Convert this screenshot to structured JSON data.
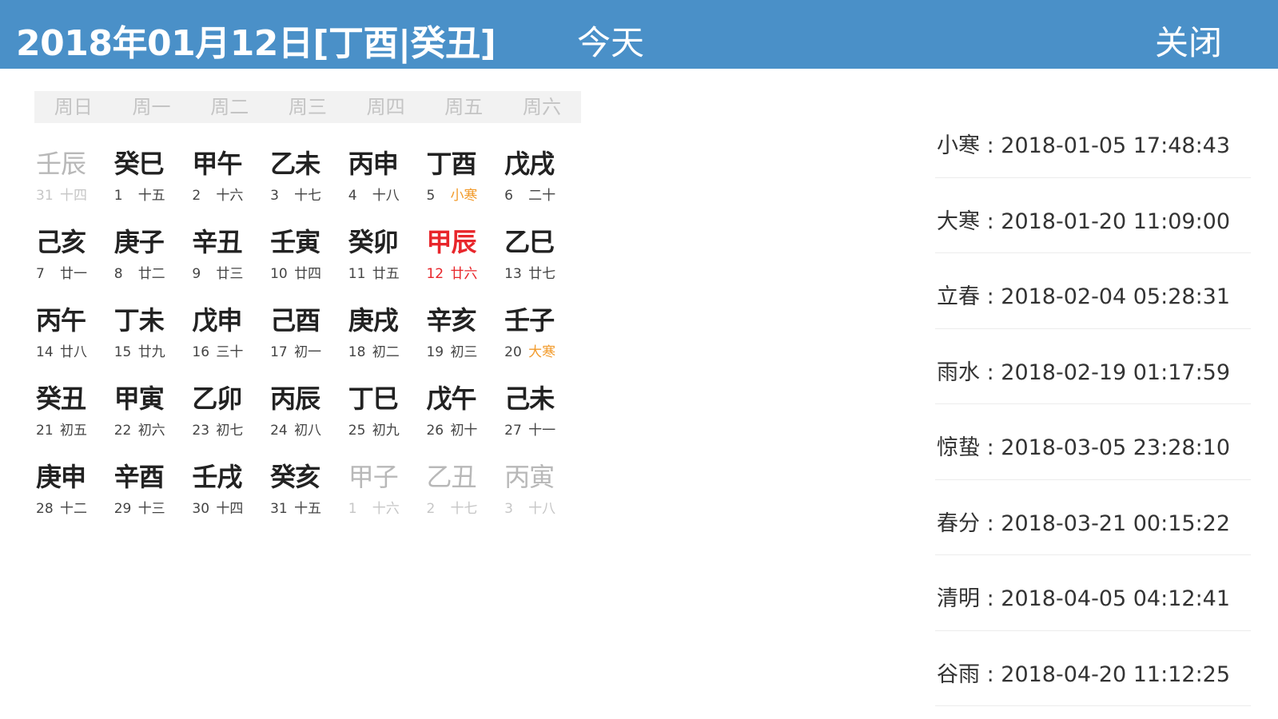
{
  "header": {
    "title": "2018年01月12日[丁酉|癸丑]",
    "today_label": "今天",
    "close_label": "关闭"
  },
  "colors": {
    "header_bg": "#4a90c8",
    "selected": "#e8262b",
    "solar_term": "#f29b2c"
  },
  "weekdays": [
    "周日",
    "周一",
    "周二",
    "周三",
    "周四",
    "周五",
    "周六"
  ],
  "calendar": {
    "selected_day": 12,
    "weeks": [
      [
        {
          "gz": "壬辰",
          "day": "31",
          "lunar": "十四",
          "other": true
        },
        {
          "gz": "癸巳",
          "day": "1",
          "lunar": "十五"
        },
        {
          "gz": "甲午",
          "day": "2",
          "lunar": "十六"
        },
        {
          "gz": "乙未",
          "day": "3",
          "lunar": "十七"
        },
        {
          "gz": "丙申",
          "day": "4",
          "lunar": "十八"
        },
        {
          "gz": "丁酉",
          "day": "5",
          "lunar": "小寒",
          "term": true
        },
        {
          "gz": "戊戌",
          "day": "6",
          "lunar": "二十"
        }
      ],
      [
        {
          "gz": "己亥",
          "day": "7",
          "lunar": "廿一"
        },
        {
          "gz": "庚子",
          "day": "8",
          "lunar": "廿二"
        },
        {
          "gz": "辛丑",
          "day": "9",
          "lunar": "廿三"
        },
        {
          "gz": "壬寅",
          "day": "10",
          "lunar": "廿四"
        },
        {
          "gz": "癸卯",
          "day": "11",
          "lunar": "廿五"
        },
        {
          "gz": "甲辰",
          "day": "12",
          "lunar": "廿六",
          "selected": true
        },
        {
          "gz": "乙巳",
          "day": "13",
          "lunar": "廿七"
        }
      ],
      [
        {
          "gz": "丙午",
          "day": "14",
          "lunar": "廿八"
        },
        {
          "gz": "丁未",
          "day": "15",
          "lunar": "廿九"
        },
        {
          "gz": "戊申",
          "day": "16",
          "lunar": "三十"
        },
        {
          "gz": "己酉",
          "day": "17",
          "lunar": "初一"
        },
        {
          "gz": "庚戌",
          "day": "18",
          "lunar": "初二"
        },
        {
          "gz": "辛亥",
          "day": "19",
          "lunar": "初三"
        },
        {
          "gz": "壬子",
          "day": "20",
          "lunar": "大寒",
          "term": true
        }
      ],
      [
        {
          "gz": "癸丑",
          "day": "21",
          "lunar": "初五"
        },
        {
          "gz": "甲寅",
          "day": "22",
          "lunar": "初六"
        },
        {
          "gz": "乙卯",
          "day": "23",
          "lunar": "初七"
        },
        {
          "gz": "丙辰",
          "day": "24",
          "lunar": "初八"
        },
        {
          "gz": "丁巳",
          "day": "25",
          "lunar": "初九"
        },
        {
          "gz": "戊午",
          "day": "26",
          "lunar": "初十"
        },
        {
          "gz": "己未",
          "day": "27",
          "lunar": "十一"
        }
      ],
      [
        {
          "gz": "庚申",
          "day": "28",
          "lunar": "十二"
        },
        {
          "gz": "辛酉",
          "day": "29",
          "lunar": "十三"
        },
        {
          "gz": "壬戌",
          "day": "30",
          "lunar": "十四"
        },
        {
          "gz": "癸亥",
          "day": "31",
          "lunar": "十五"
        },
        {
          "gz": "甲子",
          "day": "1",
          "lunar": "十六",
          "other": true
        },
        {
          "gz": "乙丑",
          "day": "2",
          "lunar": "十七",
          "other": true
        },
        {
          "gz": "丙寅",
          "day": "3",
          "lunar": "十八",
          "other": true
        }
      ]
    ]
  },
  "solar_terms": [
    "小寒 : 2018-01-05 17:48:43",
    "大寒 : 2018-01-20 11:09:00",
    "立春 : 2018-02-04 05:28:31",
    "雨水 : 2018-02-19 01:17:59",
    "惊蛰 : 2018-03-05 23:28:10",
    "春分 : 2018-03-21 00:15:22",
    "清明 : 2018-04-05 04:12:41",
    "谷雨 : 2018-04-20 11:12:25"
  ]
}
